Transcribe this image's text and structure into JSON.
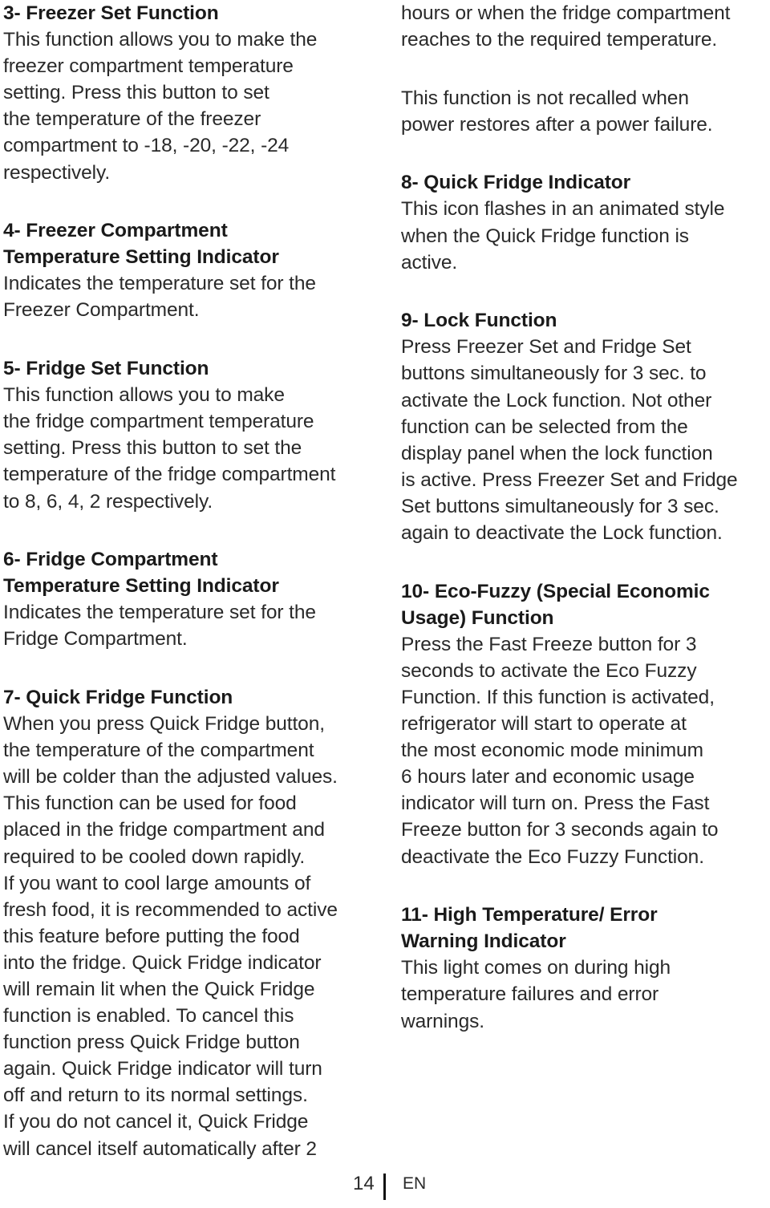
{
  "page": {
    "left_column": [
      {
        "title_lines": [
          "3- Freezer Set Function"
        ],
        "body_lines": [
          "This function allows you to make the",
          "freezer compartment temperature",
          "setting. Press this button to set",
          "the temperature of the freezer",
          "compartment to -18, -20, -22, -24",
          "respectively."
        ]
      },
      {
        "title_lines": [
          "4- Freezer Compartment",
          "Temperature Setting Indicator"
        ],
        "body_lines": [
          "Indicates the temperature set for the",
          "Freezer Compartment."
        ]
      },
      {
        "title_lines": [
          "5- Fridge Set Function"
        ],
        "body_lines": [
          "This function allows you to make",
          "the fridge compartment temperature",
          "setting. Press this button to set the",
          "temperature of the fridge compartment",
          "to 8, 6, 4, 2 respectively."
        ]
      },
      {
        "title_lines": [
          "6- Fridge Compartment",
          "Temperature Setting Indicator"
        ],
        "body_lines": [
          "Indicates the temperature set for the",
          "Fridge Compartment."
        ]
      },
      {
        "title_lines": [
          "7- Quick Fridge Function"
        ],
        "body_lines": [
          "When you press Quick Fridge button,",
          "the temperature of the compartment",
          "will be colder than the adjusted values.",
          "This function can be used for food",
          "placed in the fridge compartment and",
          "required to be cooled down rapidly.",
          "If you want to cool large amounts of",
          "fresh food, it is recommended to active",
          "this feature before putting the food",
          "into the fridge. Quick Fridge indicator",
          "will remain lit when the Quick Fridge",
          "function is enabled. To cancel this",
          "function press Quick Fridge button",
          "again. Quick Fridge indicator will turn",
          "off and return to its normal settings.",
          "If you do not cancel it, Quick Fridge",
          "will cancel itself automatically after 2"
        ]
      }
    ],
    "right_column": [
      {
        "title_lines": [],
        "body_lines": [
          "hours or when the fridge compartment",
          "reaches to the required temperature."
        ]
      },
      {
        "title_lines": [],
        "body_lines": [
          "This function is not recalled when",
          "power restores after a power failure."
        ]
      },
      {
        "title_lines": [
          "8- Quick Fridge Indicator"
        ],
        "body_lines": [
          "This icon flashes in an animated style",
          "when the Quick Fridge function is",
          "active."
        ]
      },
      {
        "title_lines": [
          "9- Lock Function"
        ],
        "body_lines": [
          "Press Freezer Set and Fridge Set",
          "buttons simultaneously for 3 sec. to",
          "activate the Lock function. Not other",
          "function can be selected from the",
          "display panel when the lock function",
          "is active. Press Freezer Set and Fridge",
          "Set buttons simultaneously for 3 sec.",
          "again to deactivate the Lock function."
        ]
      },
      {
        "title_lines": [
          "10- Eco-Fuzzy (Special Economic",
          "Usage) Function"
        ],
        "body_lines": [
          "Press the Fast Freeze button for 3",
          "seconds to activate the Eco Fuzzy",
          "Function. If this function is activated,",
          "refrigerator will start to operate at",
          "the most economic mode minimum",
          "6 hours later and economic usage",
          "indicator will turn on. Press the Fast",
          "Freeze button for 3 seconds again to",
          "deactivate the Eco Fuzzy Function."
        ]
      },
      {
        "title_lines": [
          "11- High Temperature/ Error",
          "Warning Indicator"
        ],
        "body_lines": [
          "This light comes on during high",
          "temperature failures and error",
          "warnings."
        ]
      }
    ],
    "footer": {
      "page_number": "14",
      "language": "EN"
    }
  }
}
